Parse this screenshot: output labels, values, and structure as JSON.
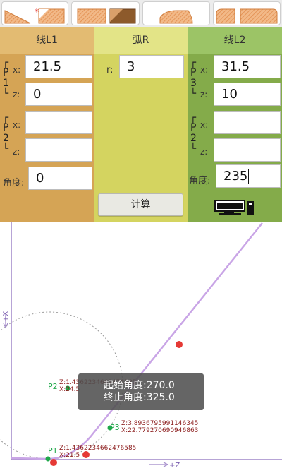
{
  "columns": {
    "l1": {
      "title": "线L1",
      "p1_label": "P1",
      "p2_label": "P2",
      "x1": "21.5",
      "z1": "0",
      "x2": "",
      "z2": "",
      "angle_label": "角度:",
      "angle": "0"
    },
    "r": {
      "title": "弧R",
      "r_label": "r:",
      "r_value": "3",
      "calc_label": "计算"
    },
    "l2": {
      "title": "线L2",
      "p3_label": "P3",
      "p2_label": "P2",
      "x1": "31.5",
      "z1": "10",
      "x2": "",
      "z2": "",
      "angle_label": "角度:",
      "angle": "235"
    }
  },
  "labels": {
    "x": "x:",
    "z": "z:"
  },
  "plot": {
    "axis_x_label": "+X",
    "axis_z_label": "+Z",
    "points": {
      "p1": {
        "name": "P1",
        "z": "Z:1.4362234662476585",
        "x": "X:21.5"
      },
      "p2": {
        "name": "P2",
        "z": "Z:1.4362234662476585",
        "x": "X:24.5"
      },
      "p3": {
        "name": "P3",
        "z": "Z:3.8936795991146345",
        "x": "X:22.779270690946863"
      }
    },
    "toast": {
      "start": "起始角度:270.0",
      "end": "终止角度:325.0"
    }
  },
  "colors": {
    "l1": "#d5a455",
    "r": "#d4d460",
    "l2": "#84ab4a",
    "curve": "#c9a5e6",
    "point_green": "#1fa84a",
    "point_red": "#e53935"
  },
  "icons": {
    "save": "computer-icon"
  }
}
